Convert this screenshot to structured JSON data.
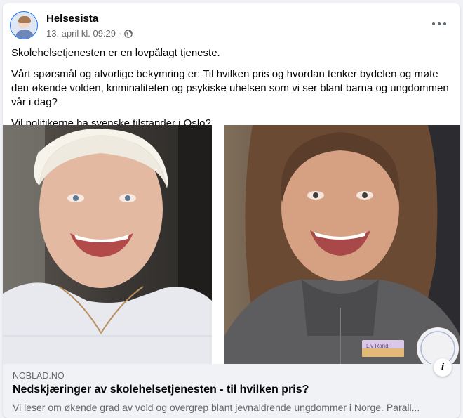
{
  "post": {
    "author": "Helsesista",
    "timestamp": "13. april kl. 09:29",
    "separator": "·",
    "privacy_icon": "globe-icon",
    "more_icon": "more-horizontal-icon",
    "paragraphs": [
      "Skolehelsetjenesten er en lovpålagt tjeneste.",
      "Vårt spørsmål og alvorlige bekymring er: Til hvilken pris og hvordan tenker bydelen og møte den økende volden, kriminaliteten og psykiske uhelsen som vi ser blant barna og ungdommen vår i dag?",
      "Vil politikerne ha svenske tilstander i Oslo?"
    ]
  },
  "link_preview": {
    "domain": "NOBLAD.NO",
    "title": "Nedskjæringer av skolehelsetjenesten - til hvilken pris?",
    "description": "Vi leser om økende grad av vold og overgrep blant jevnaldrende ungdommer i Norge. Parall...",
    "info_label": "i",
    "name_badge": "Liv Rand"
  },
  "colors": {
    "accent": "#1877f2",
    "secondary_text": "#65676b",
    "link_bg": "#f0f2f5"
  }
}
